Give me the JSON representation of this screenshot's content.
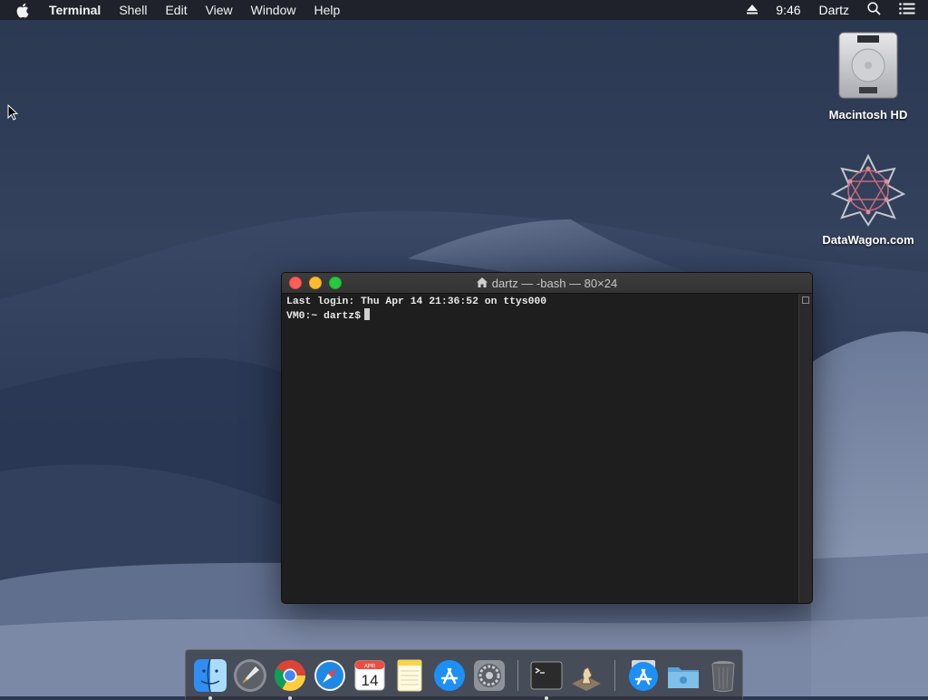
{
  "menubar": {
    "app_name": "Terminal",
    "items": [
      "Shell",
      "Edit",
      "View",
      "Window",
      "Help"
    ],
    "clock": "9:46",
    "user": "Dartz"
  },
  "desktop": {
    "icons": [
      {
        "label": "Macintosh HD",
        "icon": "hard-drive-icon"
      },
      {
        "label": "DataWagon.com",
        "icon": "datawagon-logo-icon"
      }
    ]
  },
  "terminal": {
    "title": "dartz — -bash — 80×24",
    "lines": [
      "Last login: Thu Apr 14 21:36:52 on ttys000",
      "VM0:~ dartz$"
    ]
  },
  "dock": {
    "calendar_month": "APR",
    "calendar_day": "14",
    "items": [
      {
        "name": "finder-icon",
        "running": true
      },
      {
        "name": "launchpad-icon",
        "running": false
      },
      {
        "name": "chrome-icon",
        "running": true
      },
      {
        "name": "safari-icon",
        "running": false
      },
      {
        "name": "calendar-icon",
        "running": false
      },
      {
        "name": "notes-icon",
        "running": false
      },
      {
        "name": "app-store-icon",
        "running": false
      },
      {
        "name": "system-preferences-icon",
        "running": false
      },
      {
        "name": "terminal-icon",
        "running": true
      },
      {
        "name": "chess-icon",
        "running": false
      },
      {
        "name": "downloads-stack-icon",
        "running": false
      },
      {
        "name": "folder-icon",
        "running": false
      },
      {
        "name": "trash-icon",
        "running": false
      }
    ]
  },
  "colors": {
    "menubar_bg": "#1e2128",
    "terminal_bg": "#1e1e1e",
    "close": "#fc5f57",
    "minimize": "#fdbc2e",
    "zoom": "#28c840"
  }
}
